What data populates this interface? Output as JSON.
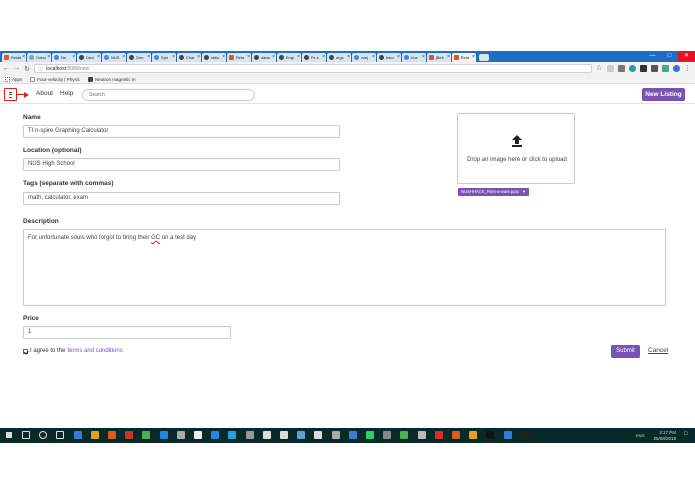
{
  "browser": {
    "tabs": [
      "Relati",
      "Gobo",
      "Ne",
      "Deci",
      "NUS",
      "Gen",
      "Spri",
      "Char",
      "stdio",
      "Rela",
      "danic",
      "Engi",
      "Fe s",
      "orgs",
      "vuej",
      "Intro",
      "Vue",
      "[Beb",
      "Rent"
    ],
    "address": {
      "host": "localhost",
      "path": ":8080/new"
    },
    "bookmarks": [
      "Apps",
      "Four-velocity | Physic",
      "Neutron magnetic m"
    ]
  },
  "navbar": {
    "about": "About",
    "help": "Help",
    "search_placeholder": "Search",
    "new_listing": "New Listing"
  },
  "form": {
    "name_label": "Name",
    "name_value": "TI n-spire Graphing Calculator",
    "location_label": "Location (optional)",
    "location_value": "NUS High School",
    "tags_label": "Tags (separate with commas)",
    "tags_value": "math, calculator, exam",
    "description_label": "Description",
    "description_before": "For unfortunate souls who forgot to bring their ",
    "description_flag": "GC",
    "description_after": " on a test day",
    "price_label": "Price",
    "price_value": "1",
    "agree_text": "I agree to the",
    "agree_link": "terms and conditions",
    "submit": "Submit",
    "cancel": "Cancel"
  },
  "upload": {
    "prompt": "Drop an image here or click to upload",
    "file_name": "NUSHHACK_Rent-a-ware.pptx"
  },
  "taskbar": {
    "time": "3:17 PM",
    "date": "25/08/2018",
    "lang": "ENG"
  },
  "colors": {
    "accent": "#7952b3",
    "annotation": "#e02020",
    "titlebar": "#1e6fc2",
    "taskbar": "#0a2a2a"
  }
}
